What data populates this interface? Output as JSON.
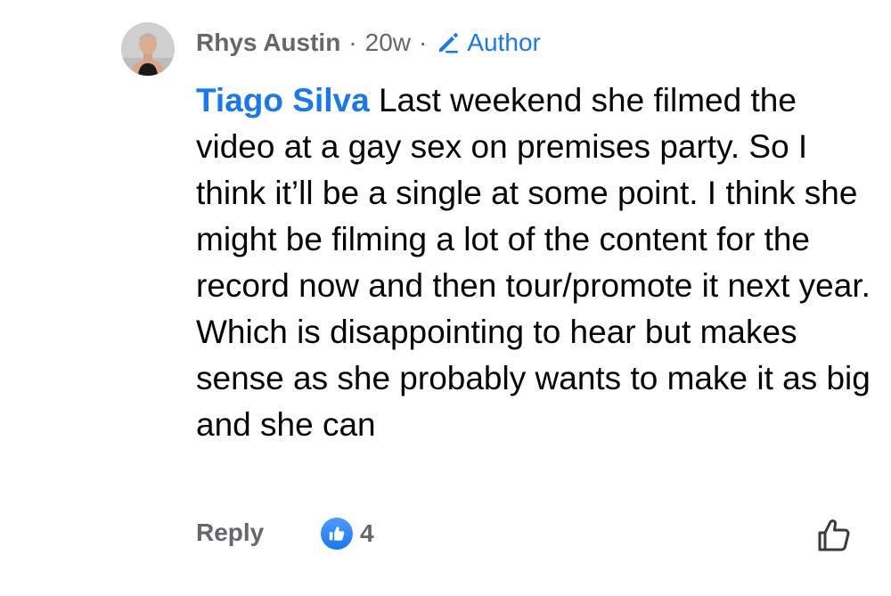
{
  "comment": {
    "author": "Rhys Austin",
    "separator": "·",
    "time": "20w",
    "badge": "Author",
    "mention": "Tiago Silva",
    "text": "Last weekend she filmed the video at a gay sex on premises party. So I think it’ll be a single at some point. I think she might be filming a lot of the content for the record now and then tour/promote it next year. Which is disappointing to hear but makes sense as she probably wants to make it as big and she can",
    "reply_label": "Reply",
    "reaction_count": "4",
    "reaction_icon": "like-thumb-icon"
  },
  "colors": {
    "accent": "#1877f2",
    "secondary_text": "#65676b",
    "primary_text": "#050505",
    "background": "#ffffff"
  }
}
